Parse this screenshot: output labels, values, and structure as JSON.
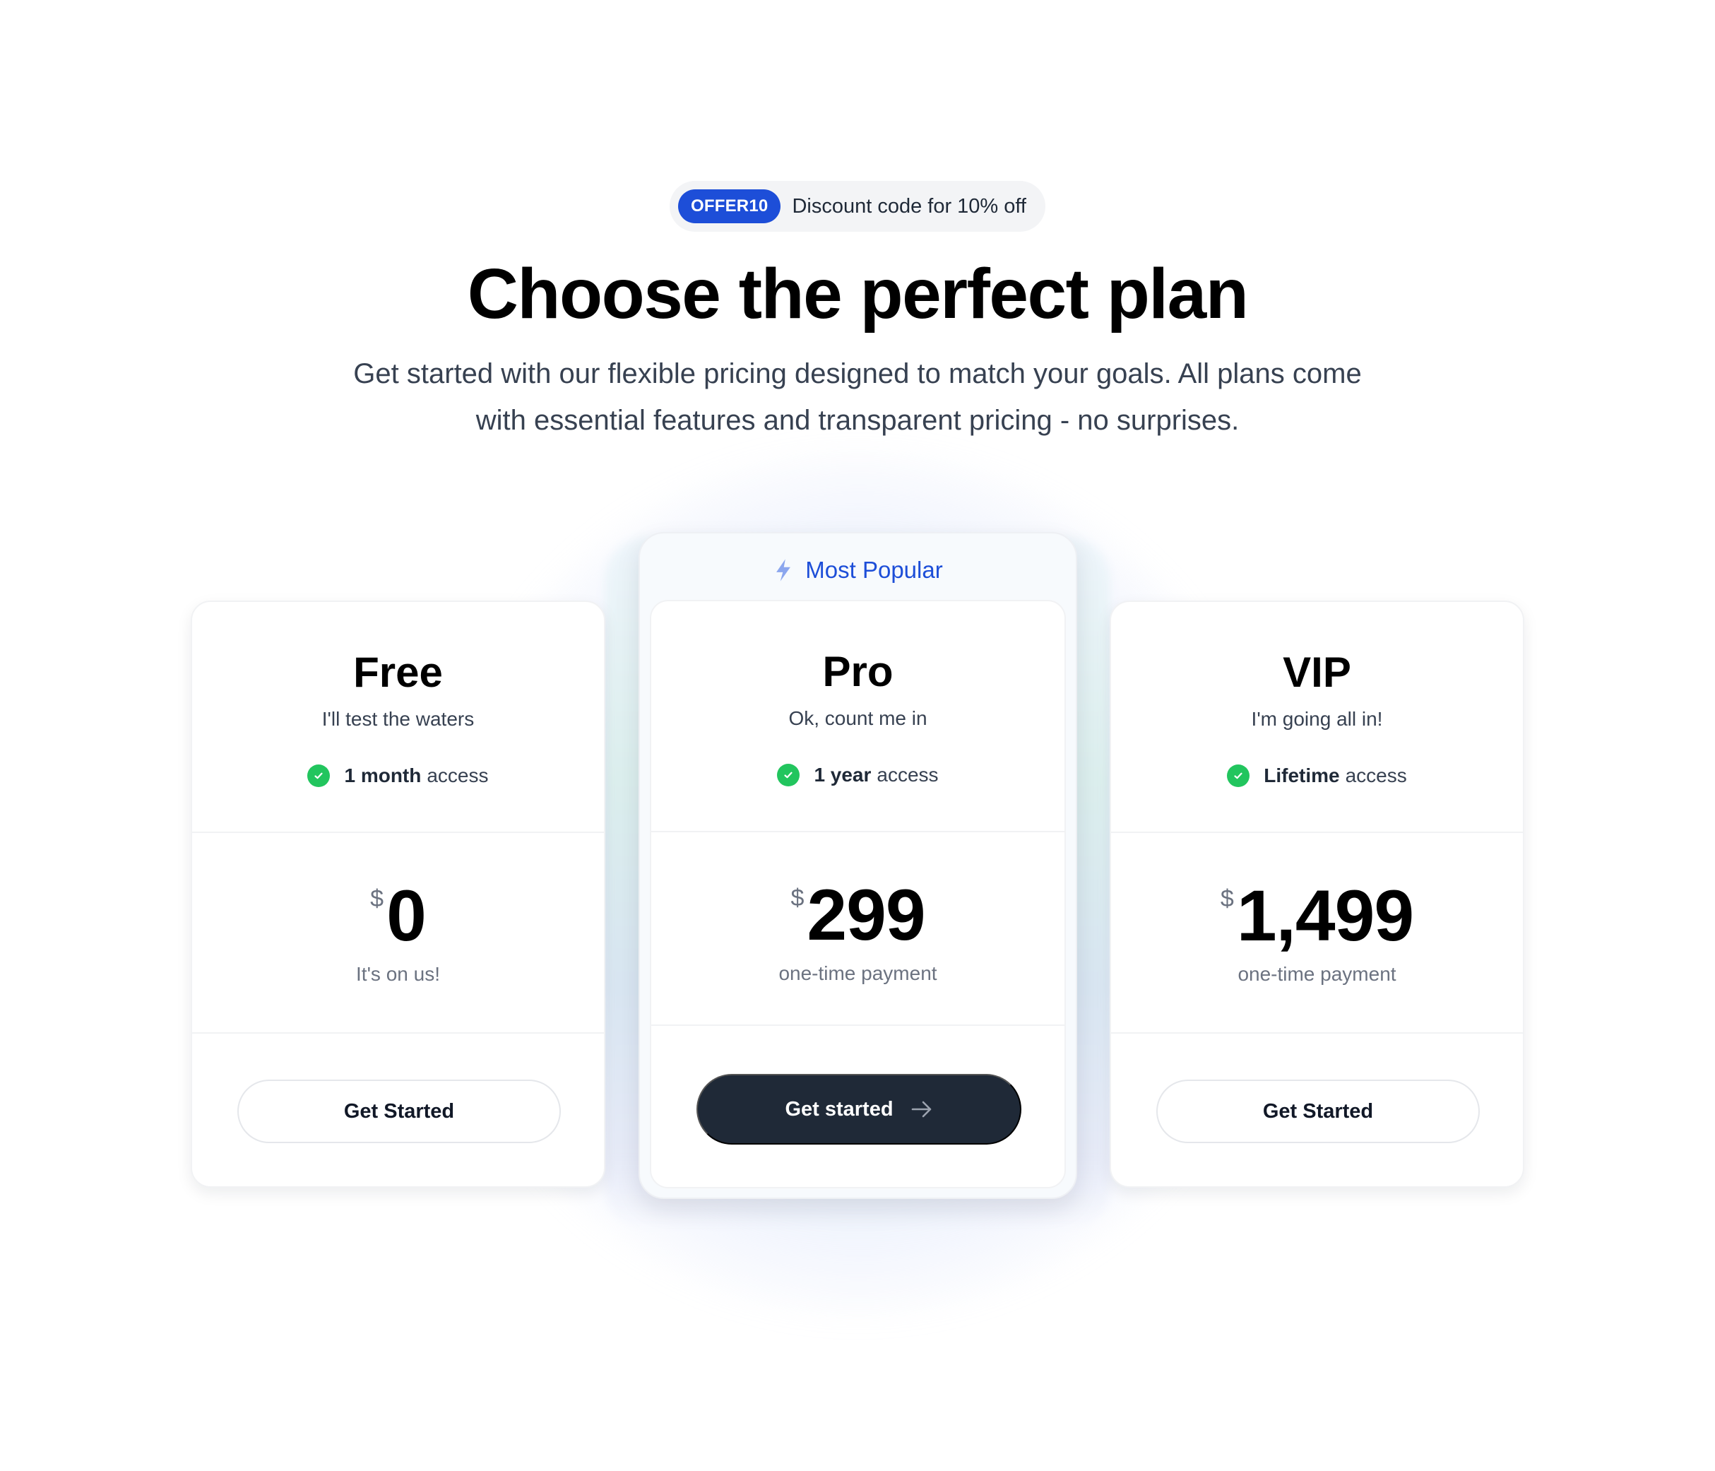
{
  "promo": {
    "code": "OFFER10",
    "text": "Discount code for 10% off",
    "accent_color": "#1d4ed8"
  },
  "header": {
    "title": "Choose the perfect plan",
    "subtitle": "Get started with our flexible pricing designed to match your goals. All plans come with essential features and transparent pricing - no surprises."
  },
  "plans": [
    {
      "name": "Free",
      "tagline": "I'll test the waters",
      "feature_strong": "1 month",
      "feature_rest": "access",
      "feature_icon": "check-circle-icon",
      "currency": "$",
      "price": "0",
      "price_note": "It's on us!",
      "cta": "Get Started"
    },
    {
      "name": "Pro",
      "badge": "Most Popular",
      "badge_icon": "lightning-bolt-icon",
      "tagline": "Ok, count me in",
      "feature_strong": "1 year",
      "feature_rest": "access",
      "feature_icon": "check-circle-icon",
      "currency": "$",
      "price": "299",
      "price_note": "one-time payment",
      "cta": "Get started",
      "cta_icon": "arrow-right-icon"
    },
    {
      "name": "VIP",
      "tagline": "I'm going all in!",
      "feature_strong": "Lifetime",
      "feature_rest": "access",
      "feature_icon": "check-circle-icon",
      "currency": "$",
      "price": "1,499",
      "price_note": "one-time payment",
      "cta": "Get Started"
    }
  ],
  "colors": {
    "check_green": "#22c55e",
    "primary_button": "#1f2937",
    "badge_blue": "#1d4ed8"
  }
}
